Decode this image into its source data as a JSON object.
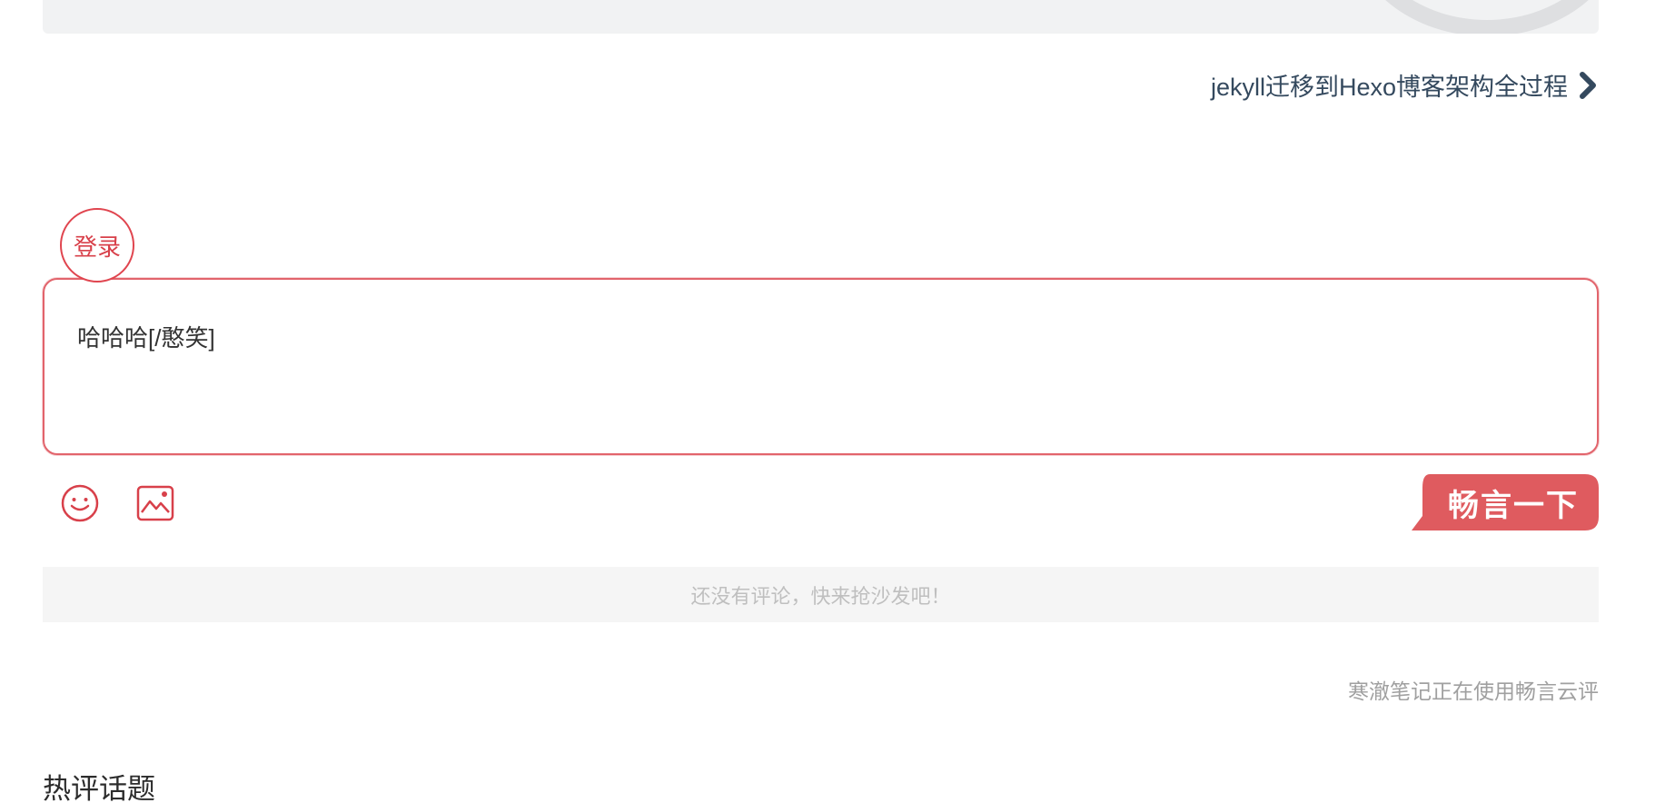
{
  "next_post": {
    "label": "jekyll迁移到Hexo博客架构全过程",
    "icon": "chevron-right-icon"
  },
  "comment": {
    "login_label": "登录",
    "input_value": "哈哈哈[/憨笑]",
    "emoji_icon": "smile-icon",
    "image_icon": "image-icon",
    "submit_label": "畅言一下",
    "empty_notice": "还没有评论，快来抢沙发吧！",
    "powered_by": "寒澈笔记正在使用畅言云评"
  },
  "hot_topics": {
    "title": "热评话题"
  },
  "colors": {
    "accent": "#e0454f",
    "submit_bg": "#df5b5f",
    "link": "#34495e",
    "muted": "#a0a0a0",
    "notice_bg": "#f5f5f5"
  }
}
